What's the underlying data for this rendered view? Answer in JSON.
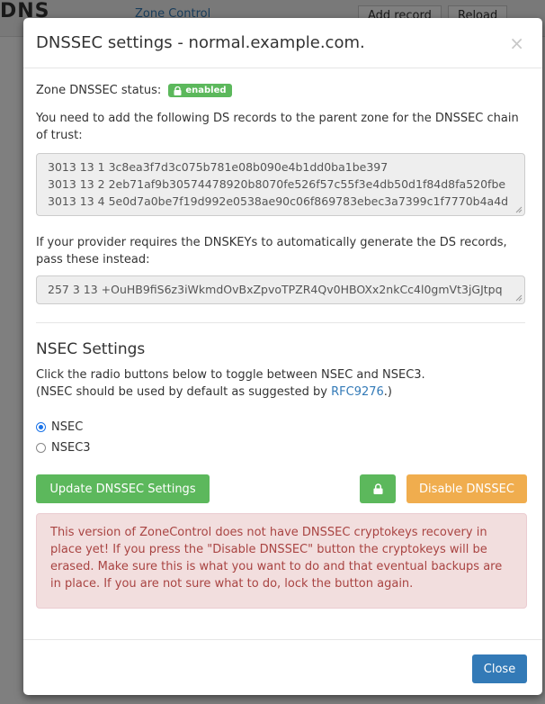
{
  "background": {
    "logo_text": "DNS",
    "brand_link": "Zone Control",
    "buttons": [
      "Add record",
      "Reload"
    ]
  },
  "modal": {
    "title": "DNSSEC settings - normal.example.com.",
    "close_glyph": "×",
    "status_label": "Zone DNSSEC status:",
    "status_badge": "enabled",
    "ds_intro": "You need to add the following DS records to the parent zone for the DNSSEC chain of trust:",
    "ds_records": [
      "3013 13 1 3c8ea3f7d3c075b781e08b090e4b1dd0ba1be397",
      "3013 13 2 2eb71af9b30574478920b8070fe526f57c55f3e4db50d1f84d8fa520fbe",
      "3013 13 4 5e0d7a0be7f19d992e0538ae90c06f869783ebec3a7399c1f7770b4a4d"
    ],
    "dnskey_intro": "If your provider requires the DNSKEYs to automatically generate the DS records, pass these instead:",
    "dnskey_record": "257 3 13 +OuHB9fiS6z3iWkmdOvBxZpvoTPZR4Qv0HBOXx2nkCc4l0gmVt3jGJtpq",
    "nsec": {
      "title": "NSEC Settings",
      "help_line1": "Click the radio buttons below to toggle between NSEC and NSEC3.",
      "help_line2_pre": "(NSEC should be used by default as suggested by ",
      "help_link": "RFC9276",
      "help_line2_post": ".)",
      "options": [
        {
          "label": "NSEC",
          "checked": true
        },
        {
          "label": "NSEC3",
          "checked": false
        }
      ]
    },
    "update_button": "Update DNSSEC Settings",
    "disable_button": "Disable DNSSEC",
    "warning": "This version of ZoneControl does not have DNSSEC cryptokeys recovery in place yet! If you press the \"Disable DNSSEC\" button the cryptokeys will be erased. Make sure this is what you want to do and that eventual backups are in place. If you are not sure what to do, lock the button again.",
    "close_button": "Close"
  },
  "colors": {
    "success": "#5cb85c",
    "warning": "#f0ad4e",
    "primary": "#337ab7",
    "danger_bg": "#f2dede",
    "danger_text": "#a94442"
  }
}
